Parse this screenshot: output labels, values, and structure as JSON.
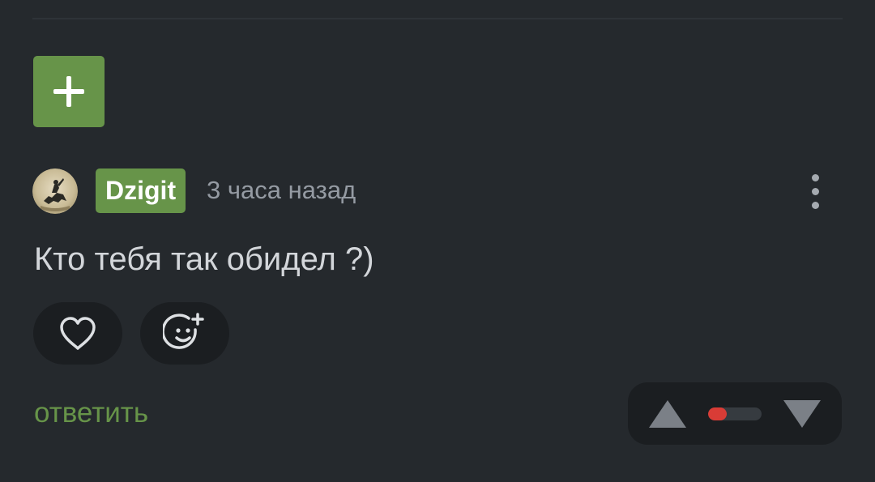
{
  "colors": {
    "background": "#25292d",
    "accent_green": "#679449",
    "button_dark": "#1b1e21",
    "text_main": "#d3d6da",
    "text_muted": "#959ba3",
    "rating_negative": "#d93c36"
  },
  "expand_button": {
    "icon": "plus-icon"
  },
  "comment": {
    "avatar": {
      "icon": "avatar-horseman-image"
    },
    "author": "Dzigit",
    "timestamp": "3 часа назад",
    "more_icon": "more-vertical-icon",
    "text": "Кто тебя так обидел ?)",
    "actions": {
      "like_icon": "heart-icon",
      "react_icon": "add-emoji-icon",
      "reply_label": "ответить"
    },
    "rating": {
      "up_icon": "triangle-up-icon",
      "down_icon": "triangle-down-icon",
      "positive_share": 0.35
    }
  }
}
